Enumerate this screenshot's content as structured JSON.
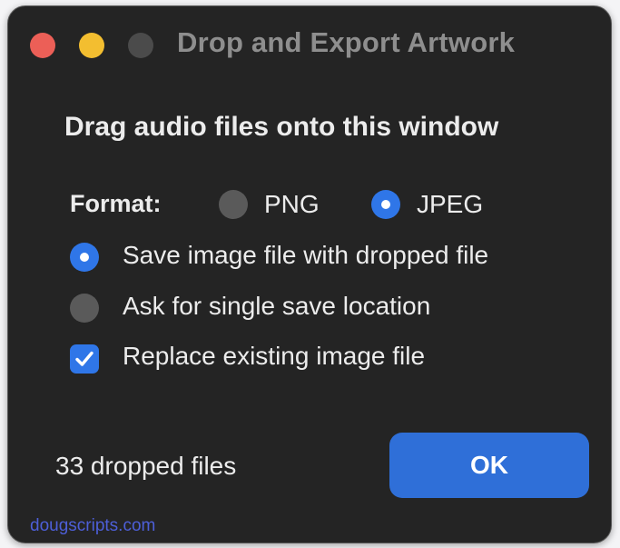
{
  "window": {
    "title": "Drop and Export Artwork"
  },
  "dialog": {
    "heading": "Drag audio files onto this window",
    "format_label": "Format:",
    "format_options": [
      {
        "label": "PNG",
        "selected": false
      },
      {
        "label": "JPEG",
        "selected": true
      }
    ],
    "save_options": [
      {
        "label": "Save image file with dropped file",
        "selected": true
      },
      {
        "label": "Ask for single save location",
        "selected": false
      }
    ],
    "replace_checkbox": {
      "label": "Replace existing image file",
      "checked": true
    },
    "status_text": "33 dropped files",
    "ok_label": "OK",
    "credit": "dougscripts.com"
  },
  "colors": {
    "window_bg": "#242424",
    "accent": "#2f76e8",
    "close": "#ec5f57",
    "minimize": "#f3be30",
    "zoom_disabled": "#4b4b4b",
    "credit_link": "#4d5fd8"
  },
  "icons": {
    "close": "close-button",
    "minimize": "minimize-button",
    "zoom": "zoom-button",
    "check": "checkmark-icon"
  }
}
